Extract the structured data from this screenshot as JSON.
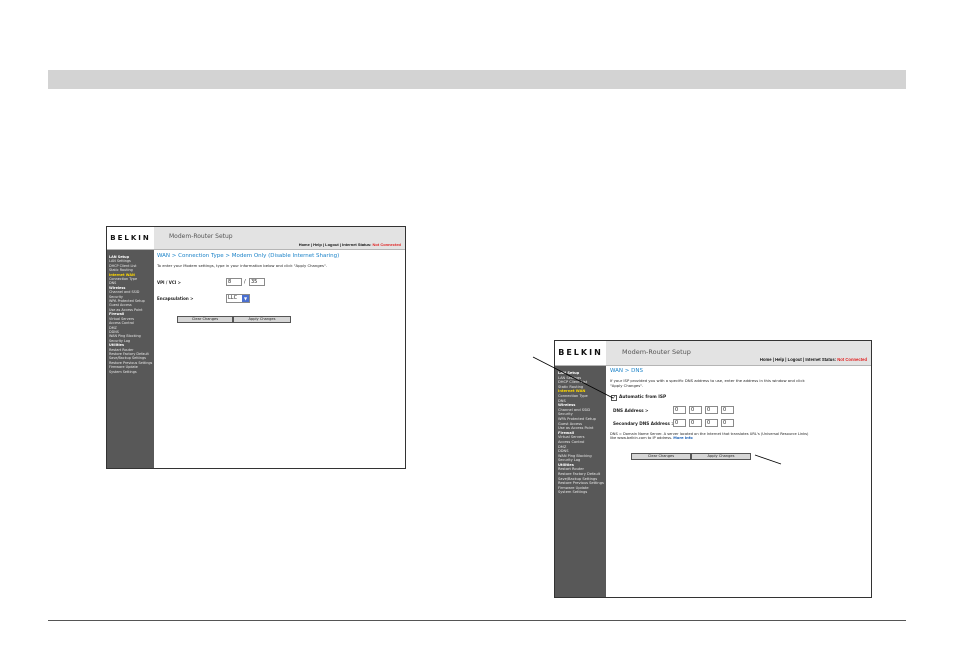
{
  "screenshot_left": {
    "brand": "BELKIN",
    "title": "Modem-Router Setup",
    "nav": {
      "home": "Home",
      "help": "Help",
      "logout": "Logout",
      "status_label": "Internet Status:",
      "status_value": "Not Connected"
    },
    "sidebar": [
      {
        "text": "LAN Setup",
        "kind": "h"
      },
      {
        "text": "LAN Settings",
        "kind": "n"
      },
      {
        "text": "DHCP Client List",
        "kind": "n"
      },
      {
        "text": "Static Routing",
        "kind": "n"
      },
      {
        "text": "Internet WAN",
        "kind": "hl"
      },
      {
        "text": "Connection Type",
        "kind": "n"
      },
      {
        "text": "DNS",
        "kind": "n"
      },
      {
        "text": "Wireless",
        "kind": "h"
      },
      {
        "text": "Channel and SSID",
        "kind": "n"
      },
      {
        "text": "Security",
        "kind": "n"
      },
      {
        "text": "WPA Protected Setup",
        "kind": "n"
      },
      {
        "text": "Guest Access",
        "kind": "n"
      },
      {
        "text": "Use as Access Point",
        "kind": "n"
      },
      {
        "text": "Firewall",
        "kind": "h"
      },
      {
        "text": "Virtual Servers",
        "kind": "n"
      },
      {
        "text": "Access Control",
        "kind": "n"
      },
      {
        "text": "DMZ",
        "kind": "n"
      },
      {
        "text": "DDNS",
        "kind": "n"
      },
      {
        "text": "WAN Ping Blocking",
        "kind": "n"
      },
      {
        "text": "Security Log",
        "kind": "n"
      },
      {
        "text": "Utilities",
        "kind": "h"
      },
      {
        "text": "Restart Router",
        "kind": "n"
      },
      {
        "text": "Restore Factory Default",
        "kind": "n"
      },
      {
        "text": "Save/Backup Settings",
        "kind": "n"
      },
      {
        "text": "Restore Previous Settings",
        "kind": "n"
      },
      {
        "text": "Firmware Update",
        "kind": "n"
      },
      {
        "text": "System Settings",
        "kind": "n"
      }
    ],
    "breadcrumb": "WAN > Connection Type > Modem Only (Disable Internet Sharing)",
    "intro": "To enter your Modem settings, type in your information below and click \"Apply Changes\".",
    "vpi_label": "VPI / VCI >",
    "vpi_value": "8",
    "separator": "/",
    "vci_value": "35",
    "encap_label": "Encapsulation >",
    "encap_value": "LLC",
    "clear_button": "Clear Changes",
    "apply_button": "Apply Changes"
  },
  "screenshot_right": {
    "brand": "BELKIN",
    "title": "Modem-Router Setup",
    "nav": {
      "home": "Home",
      "help": "Help",
      "logout": "Logout",
      "status_label": "Internet Status:",
      "status_value": "Not Connected"
    },
    "sidebar": [
      {
        "text": "LAN Setup",
        "kind": "h"
      },
      {
        "text": "LAN Settings",
        "kind": "n"
      },
      {
        "text": "DHCP Client List",
        "kind": "n"
      },
      {
        "text": "Static Routing",
        "kind": "n"
      },
      {
        "text": "Internet WAN",
        "kind": "hl"
      },
      {
        "text": "Connection Type",
        "kind": "n"
      },
      {
        "text": "DNS",
        "kind": "n"
      },
      {
        "text": "Wireless",
        "kind": "h"
      },
      {
        "text": "Channel and SSID",
        "kind": "n"
      },
      {
        "text": "Security",
        "kind": "n"
      },
      {
        "text": "WPA Protected Setup",
        "kind": "n"
      },
      {
        "text": "Guest Access",
        "kind": "n"
      },
      {
        "text": "Use as Access Point",
        "kind": "n"
      },
      {
        "text": "Firewall",
        "kind": "h"
      },
      {
        "text": "Virtual Servers",
        "kind": "n"
      },
      {
        "text": "Access Control",
        "kind": "n"
      },
      {
        "text": "DMZ",
        "kind": "n"
      },
      {
        "text": "DDNS",
        "kind": "n"
      },
      {
        "text": "WAN Ping Blocking",
        "kind": "n"
      },
      {
        "text": "Security Log",
        "kind": "n"
      },
      {
        "text": "Utilities",
        "kind": "h"
      },
      {
        "text": "Restart Router",
        "kind": "n"
      },
      {
        "text": "Restore Factory Default",
        "kind": "n"
      },
      {
        "text": "Save/Backup Settings",
        "kind": "n"
      },
      {
        "text": "Restore Previous Settings",
        "kind": "n"
      },
      {
        "text": "Firmware Update",
        "kind": "n"
      },
      {
        "text": "System Settings",
        "kind": "n"
      }
    ],
    "breadcrumb": "WAN > DNS",
    "intro": "If your ISP provided you with a specific DNS address to use, enter the address in this window and click \"Apply Changes\".",
    "auto_label": "Automatic from ISP",
    "dns_label": "DNS Address >",
    "dns_values": [
      "0",
      "0",
      "0",
      "0"
    ],
    "secondary_label": "Secondary DNS Address >",
    "secondary_values": [
      "0",
      "0",
      "0",
      "0"
    ],
    "note": "DNS = Domain Name Server. A server located on the Internet that translates URL's (Universal Resource Links) like www.belkin.com to IP address.",
    "more_info": "More Info",
    "clear_button": "Clear Changes",
    "apply_button": "Apply Changes"
  }
}
